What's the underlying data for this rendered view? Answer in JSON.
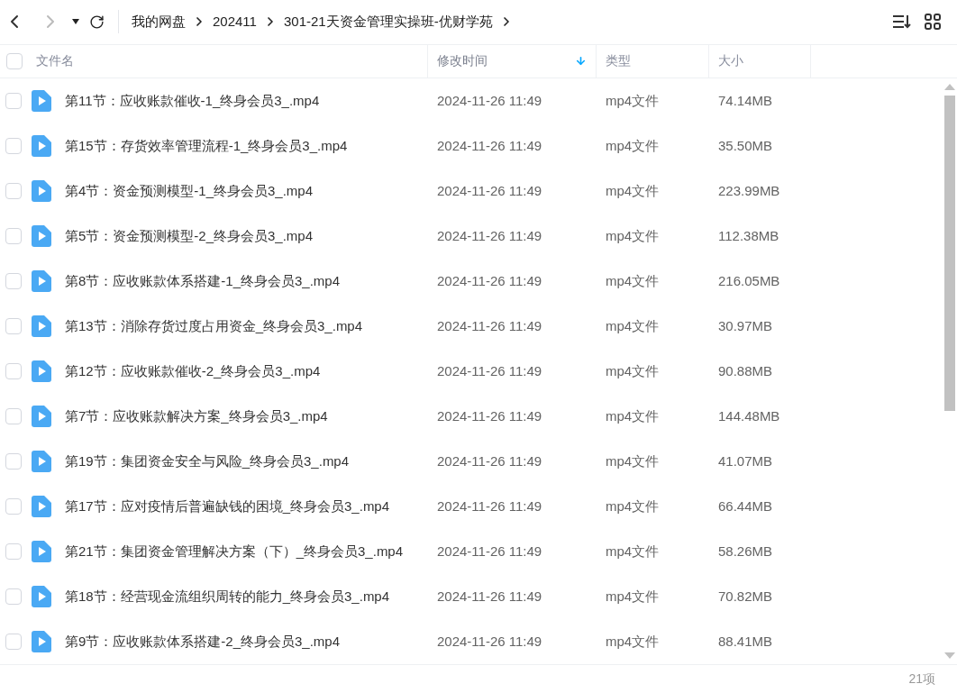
{
  "breadcrumb": [
    "我的网盘",
    "202411",
    "301-21天资金管理实操班-优财学苑"
  ],
  "header": {
    "checked": false,
    "columns": [
      {
        "label": "文件名",
        "sorted": false
      },
      {
        "label": "修改时间",
        "sorted": true
      },
      {
        "label": "类型",
        "sorted": false
      },
      {
        "label": "大小",
        "sorted": false
      }
    ]
  },
  "rows": [
    {
      "name": "第11节：应收账款催收-1_终身会员3_.mp4",
      "time": "2024-11-26 11:49",
      "type": "mp4文件",
      "size": "74.14MB",
      "checked": false
    },
    {
      "name": "第15节：存货效率管理流程-1_终身会员3_.mp4",
      "time": "2024-11-26 11:49",
      "type": "mp4文件",
      "size": "35.50MB",
      "checked": false
    },
    {
      "name": "第4节：资金预测模型-1_终身会员3_.mp4",
      "time": "2024-11-26 11:49",
      "type": "mp4文件",
      "size": "223.99MB",
      "checked": false
    },
    {
      "name": "第5节：资金预测模型-2_终身会员3_.mp4",
      "time": "2024-11-26 11:49",
      "type": "mp4文件",
      "size": "112.38MB",
      "checked": false
    },
    {
      "name": "第8节：应收账款体系搭建-1_终身会员3_.mp4",
      "time": "2024-11-26 11:49",
      "type": "mp4文件",
      "size": "216.05MB",
      "checked": false
    },
    {
      "name": "第13节：消除存货过度占用资金_终身会员3_.mp4",
      "time": "2024-11-26 11:49",
      "type": "mp4文件",
      "size": "30.97MB",
      "checked": false
    },
    {
      "name": "第12节：应收账款催收-2_终身会员3_.mp4",
      "time": "2024-11-26 11:49",
      "type": "mp4文件",
      "size": "90.88MB",
      "checked": false
    },
    {
      "name": "第7节：应收账款解决方案_终身会员3_.mp4",
      "time": "2024-11-26 11:49",
      "type": "mp4文件",
      "size": "144.48MB",
      "checked": false
    },
    {
      "name": "第19节：集团资金安全与风险_终身会员3_.mp4",
      "time": "2024-11-26 11:49",
      "type": "mp4文件",
      "size": "41.07MB",
      "checked": false
    },
    {
      "name": "第17节：应对疫情后普遍缺钱的困境_终身会员3_.mp4",
      "time": "2024-11-26 11:49",
      "type": "mp4文件",
      "size": "66.44MB",
      "checked": false
    },
    {
      "name": "第21节：集团资金管理解决方案（下）_终身会员3_.mp4",
      "time": "2024-11-26 11:49",
      "type": "mp4文件",
      "size": "58.26MB",
      "checked": false
    },
    {
      "name": "第18节：经营现金流组织周转的能力_终身会员3_.mp4",
      "time": "2024-11-26 11:49",
      "type": "mp4文件",
      "size": "70.82MB",
      "checked": false
    },
    {
      "name": "第9节：应收账款体系搭建-2_终身会员3_.mp4",
      "time": "2024-11-26 11:49",
      "type": "mp4文件",
      "size": "88.41MB",
      "checked": false
    }
  ],
  "count": "21项"
}
